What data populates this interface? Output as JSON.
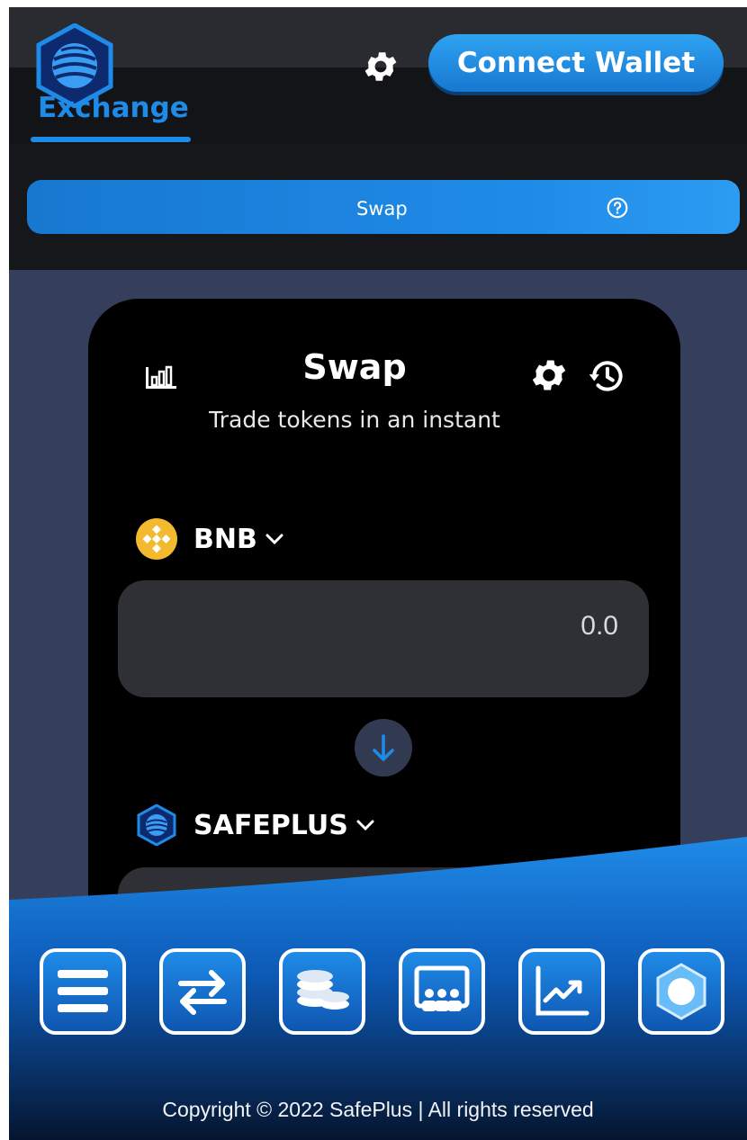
{
  "header": {
    "nav_exchange": "Exchange",
    "connect_wallet": "Connect Wallet"
  },
  "tabs": {
    "swap": "Swap"
  },
  "swap_card": {
    "title": "Swap",
    "subtitle": "Trade tokens in an instant",
    "from_token": "BNB",
    "from_amount": "0.0",
    "to_token": "SAFEPLUS"
  },
  "bottom_nav": {
    "items": [
      "menu-icon",
      "swap-arrows-icon",
      "coins-icon",
      "community-icon",
      "chart-trend-icon",
      "hexagon-logo-icon"
    ]
  },
  "footer": {
    "copyright": "Copyright © 2022 SafePlus | All rights reserved"
  },
  "colors": {
    "accent": "#1f8be8",
    "card_bg": "#000000",
    "page_bg": "#353f5c",
    "bnb_yellow": "#f3ba2f"
  }
}
